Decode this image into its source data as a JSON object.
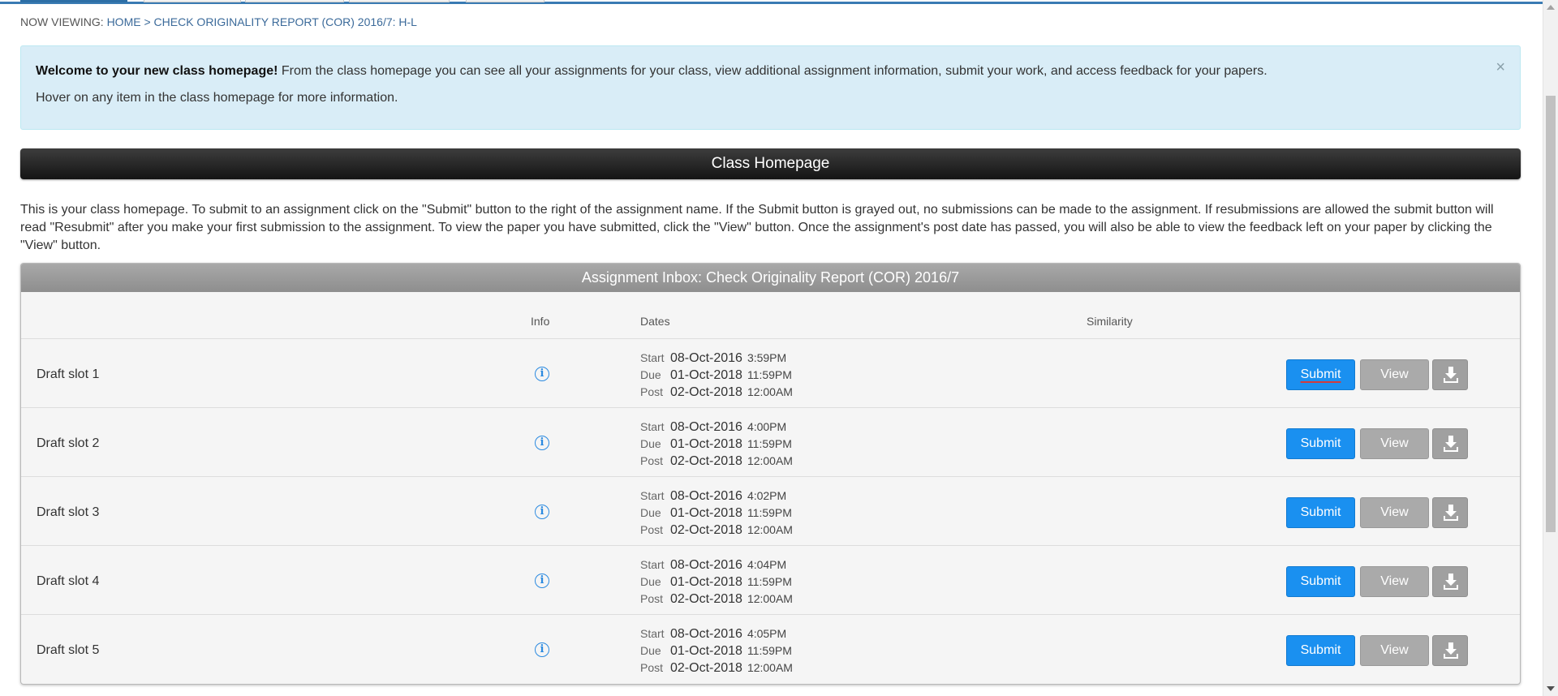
{
  "breadcrumb": {
    "label": "NOW VIEWING:",
    "home": "HOME",
    "separator": ">",
    "current": "CHECK ORIGINALITY REPORT (COR) 2016/7: H-L"
  },
  "alert": {
    "bold": "Welcome to your new class homepage!",
    "text": " From the class homepage you can see all your assignments for your class, view additional assignment information, submit your work, and access feedback for your papers.",
    "hint": "Hover on any item in the class homepage for more information.",
    "close": "×"
  },
  "banner": {
    "title": "Class Homepage"
  },
  "intro": "This is your class homepage. To submit to an assignment click on the \"Submit\" button to the right of the assignment name. If the Submit button is grayed out, no submissions can be made to the assignment. If resubmissions are allowed the submit button will read \"Resubmit\" after you make your first submission to the assignment. To view the paper you have submitted, click the \"View\" button. Once the assignment's post date has passed, you will also be able to view the feedback left on your paper by clicking the \"View\" button.",
  "inbox": {
    "title": "Assignment Inbox: Check Originality Report (COR) 2016/7",
    "columns": {
      "info": "Info",
      "dates": "Dates",
      "similarity": "Similarity"
    },
    "labels": {
      "start": "Start",
      "due": "Due",
      "post": "Post"
    },
    "buttons": {
      "submit": "Submit",
      "view": "View"
    },
    "rows": [
      {
        "name": "Draft slot 1",
        "start_date": "08-Oct-2016",
        "start_time": "3:59PM",
        "due_date": "01-Oct-2018",
        "due_time": "11:59PM",
        "post_date": "02-Oct-2018",
        "post_time": "12:00AM"
      },
      {
        "name": "Draft slot 2",
        "start_date": "08-Oct-2016",
        "start_time": "4:00PM",
        "due_date": "01-Oct-2018",
        "due_time": "11:59PM",
        "post_date": "02-Oct-2018",
        "post_time": "12:00AM"
      },
      {
        "name": "Draft slot 3",
        "start_date": "08-Oct-2016",
        "start_time": "4:02PM",
        "due_date": "01-Oct-2018",
        "due_time": "11:59PM",
        "post_date": "02-Oct-2018",
        "post_time": "12:00AM"
      },
      {
        "name": "Draft slot 4",
        "start_date": "08-Oct-2016",
        "start_time": "4:04PM",
        "due_date": "01-Oct-2018",
        "due_time": "11:59PM",
        "post_date": "02-Oct-2018",
        "post_time": "12:00AM"
      },
      {
        "name": "Draft slot 5",
        "start_date": "08-Oct-2016",
        "start_time": "4:05PM",
        "due_date": "01-Oct-2018",
        "due_time": "11:59PM",
        "post_date": "02-Oct-2018",
        "post_time": "12:00AM"
      }
    ]
  },
  "icons": {
    "info": "info-icon",
    "download": "download-icon",
    "close": "close-icon"
  },
  "colors": {
    "submit": "#1a90f0",
    "view": "#aaaaaa",
    "alert_bg": "#d9edf7",
    "banner": "#1e1e1e",
    "link": "#3b6a9a"
  }
}
